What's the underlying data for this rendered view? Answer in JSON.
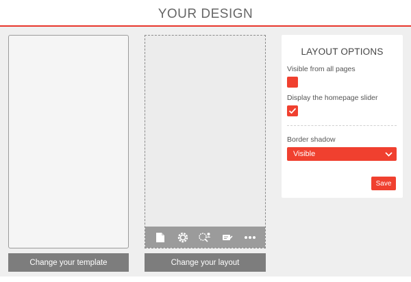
{
  "header": {
    "title": "YOUR DESIGN"
  },
  "buttons": {
    "change_template": "Change your template",
    "change_layout": "Change your layout"
  },
  "toolbar": {
    "icons": [
      "document-icon",
      "settings-cog-icon",
      "search-users-icon",
      "edit-card-icon",
      "more-dots-icon"
    ]
  },
  "layout_options": {
    "title": "LAYOUT OPTIONS",
    "visible_all_pages": {
      "label": "Visible from all pages",
      "checked": false
    },
    "homepage_slider": {
      "label": "Display the homepage slider",
      "checked": true
    },
    "border_shadow": {
      "label": "Border shadow",
      "selected": "Visible"
    },
    "save_label": "Save"
  },
  "colors": {
    "accent": "#f0402f",
    "header_rule": "#e8352b",
    "button_gray": "#7d7d7d",
    "toolbar_gray": "#9b9b9b",
    "background": "#efefef"
  }
}
